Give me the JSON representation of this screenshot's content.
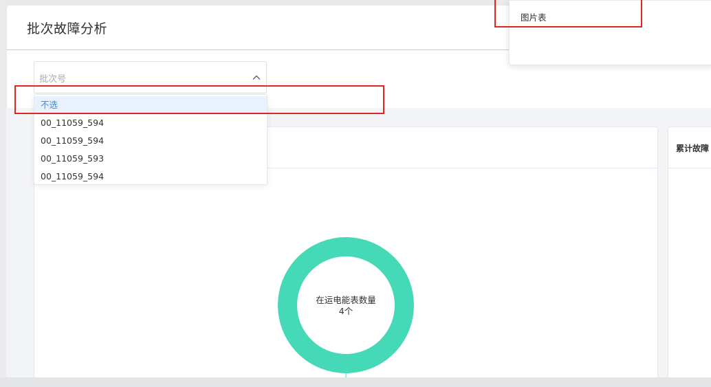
{
  "page": {
    "title": "批次故障分析"
  },
  "batch_select": {
    "placeholder": "批次号",
    "options": [
      "不选",
      "00_11059_594",
      "00_11059_594",
      "00_11059_593",
      "00_11059_594"
    ],
    "highlighted_index": 0
  },
  "popover": {
    "items": [
      "图片表"
    ]
  },
  "right_card": {
    "title": "累计故障"
  },
  "chart_data": {
    "type": "pie",
    "variant": "donut",
    "title": "在运电能表数量",
    "center_value": "4个",
    "categories": [
      "在运电能表数量"
    ],
    "values": [
      4
    ],
    "colors": [
      "#45d9b7"
    ]
  },
  "colors": {
    "accent": "#3a8ee6",
    "donut": "#45d9b7",
    "highlight": "#e0261e"
  }
}
